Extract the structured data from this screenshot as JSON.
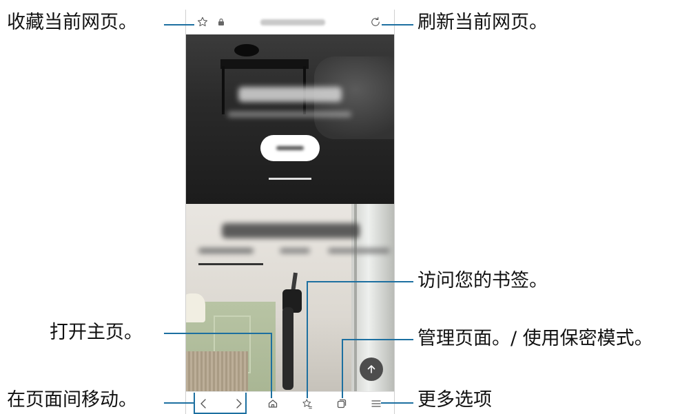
{
  "callouts": {
    "bookmark_page": "收藏当前网页。",
    "refresh_page": "刷新当前网页。",
    "bookmarks": "访问您的书签。",
    "home": "打开主页。",
    "manage_tabs": "管理页面。/ 使用保密模式。",
    "navigate": "在页面间移动。",
    "more_options": "更多选项"
  },
  "browser": {
    "url_bar": {
      "left_icons": [
        "star-outline-icon",
        "lock-icon"
      ],
      "right_icon": "refresh-icon"
    },
    "bottom_nav": [
      "back-icon",
      "forward-icon",
      "home-icon",
      "bookmarks-icon",
      "tabs-icon",
      "menu-icon"
    ],
    "scroll_top_icon": "arrow-up-icon"
  },
  "colors": {
    "callout_line": "#1c6fa0",
    "hero_dark": "#2a2a2a",
    "hero_light": "#e9e6e1"
  }
}
